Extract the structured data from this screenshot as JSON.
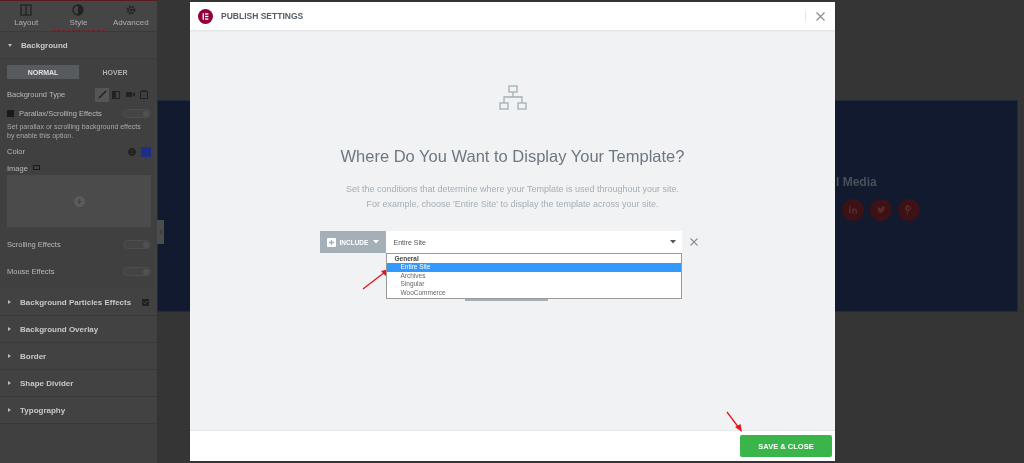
{
  "editor_panel": {
    "tabs": [
      {
        "label": "Layout",
        "kind": "layout",
        "selected": false
      },
      {
        "label": "Style",
        "kind": "style",
        "selected": true
      },
      {
        "label": "Advanced",
        "kind": "advanced",
        "selected": false
      }
    ],
    "background": {
      "title": "Background",
      "expanded": true,
      "state_tabs": [
        {
          "label": "NORMAL",
          "selected": true
        },
        {
          "label": "HOVER",
          "selected": false
        }
      ],
      "type_label": "Background Type",
      "types": [
        {
          "kind": "classic",
          "selected": true
        },
        {
          "kind": "gradient",
          "selected": false
        },
        {
          "kind": "video",
          "selected": false
        },
        {
          "kind": "slideshow",
          "selected": false
        }
      ],
      "parallax": {
        "label": "Parallax/Scrolling Effects",
        "on": false,
        "description": "Set parallax or scrolling background effects by enable this option."
      },
      "color_label": "Color",
      "color": "#1e2f8a",
      "image_label": "Image",
      "toggles": [
        {
          "label": "Scrolling Effects",
          "on": false
        },
        {
          "label": "Mouse Effects",
          "on": false
        }
      ]
    },
    "sections": [
      {
        "title": "Background Particles Effects",
        "expanded": false,
        "badge": true
      },
      {
        "title": "Background Overlay",
        "expanded": false,
        "badge": false
      },
      {
        "title": "Border",
        "expanded": false,
        "badge": false
      },
      {
        "title": "Shape Divider",
        "expanded": false,
        "badge": false
      },
      {
        "title": "Typography",
        "expanded": false,
        "badge": false
      }
    ]
  },
  "canvas": {
    "heading": "l Media",
    "social": [
      {
        "kind": "linkedin"
      },
      {
        "kind": "twitter"
      },
      {
        "kind": "pinterest"
      }
    ]
  },
  "modal": {
    "title": "PUBLISH SETTINGS",
    "heading": "Where Do You Want to Display Your Template?",
    "description": [
      "Set the conditions that determine where your Template is used throughout your site.",
      "For example, choose 'Entire Site' to display the template across your site."
    ],
    "condition": {
      "type": "INCLUDE",
      "value": "Entire Site",
      "dropdown_open": true,
      "groups": [
        {
          "label": "General",
          "options": [
            {
              "label": "Entire Site",
              "selected": true
            },
            {
              "label": "Archives",
              "selected": false
            },
            {
              "label": "Singular",
              "selected": false
            },
            {
              "label": "WooCommerce",
              "selected": false
            }
          ]
        }
      ]
    },
    "save_button": "SAVE & CLOSE"
  }
}
